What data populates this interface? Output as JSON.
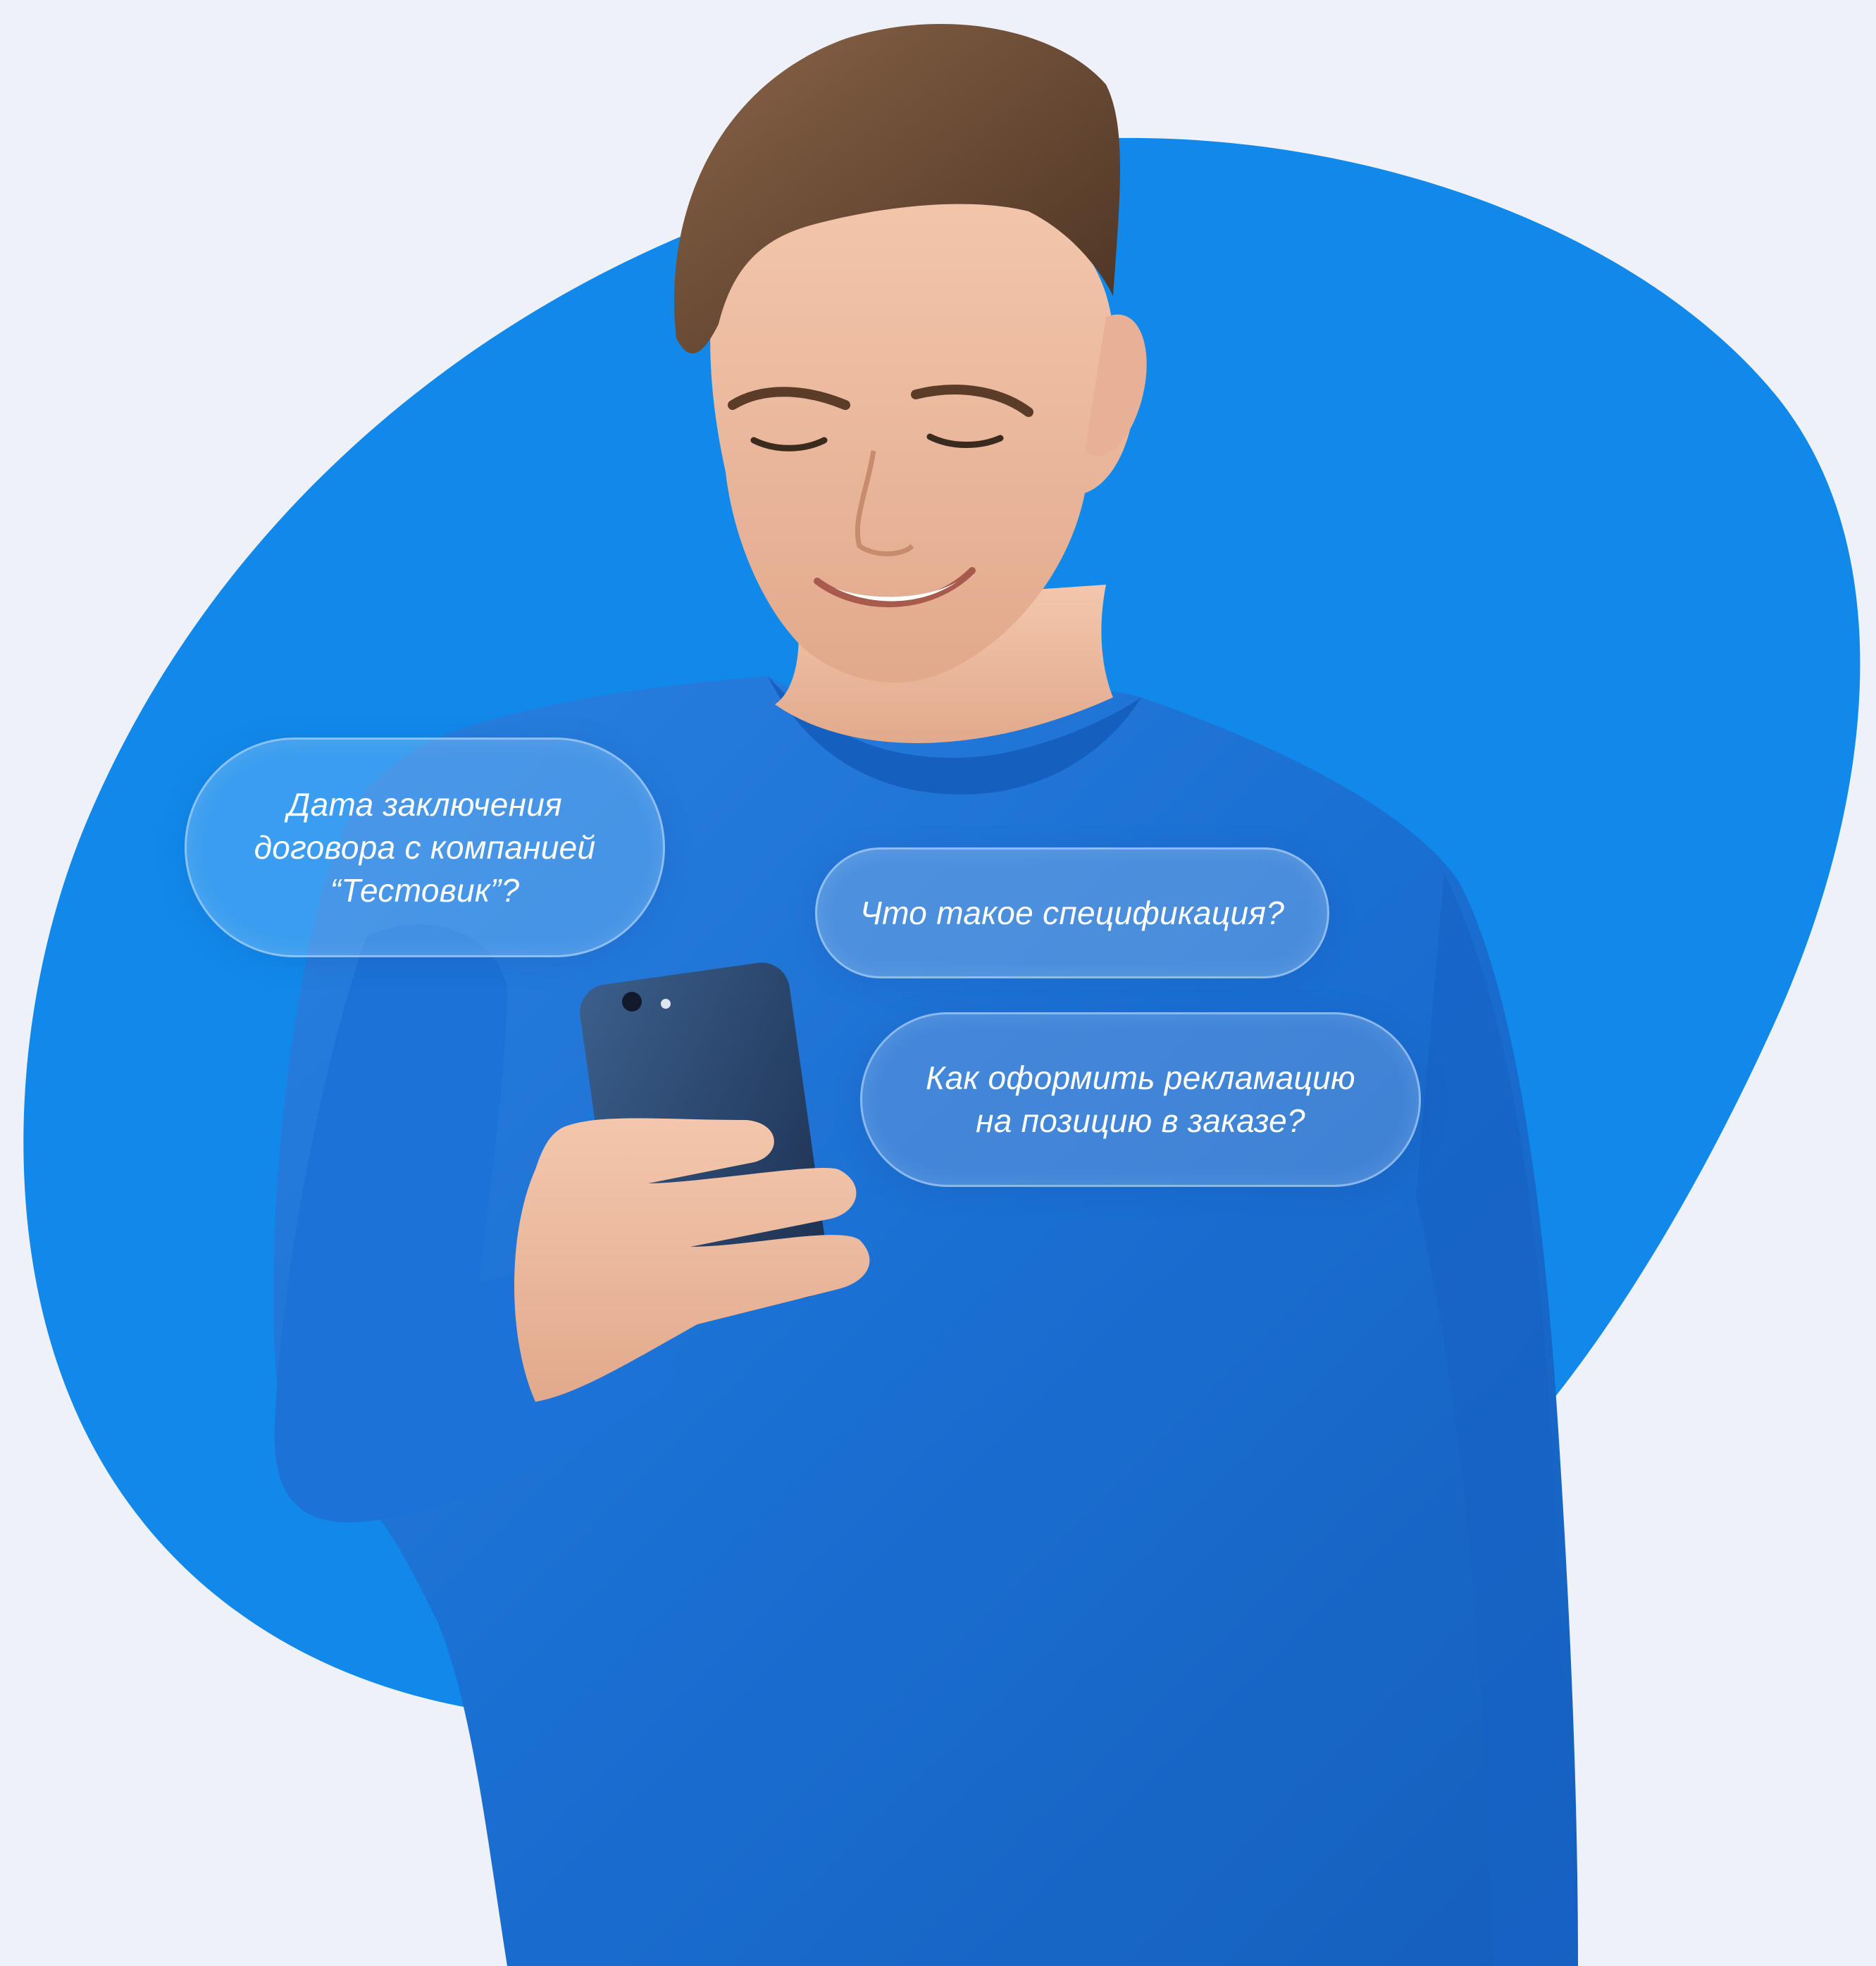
{
  "palette": {
    "background": "#eef1f8",
    "blob": "#1189ea",
    "sweater": "#1a6fd2",
    "bubble_text": "#ffffff"
  },
  "illustration": {
    "subject": "young man in blue sweater looking at smartphone",
    "icons": [
      "person-photo",
      "smartphone-icon"
    ]
  },
  "bubbles": [
    {
      "text": "Дата заключения\nдоговора с компанией\n“Тестовик”?"
    },
    {
      "text": "Что такое спецификация?"
    },
    {
      "text": "Как оформить рекламацию\nна позицию в заказе?"
    }
  ]
}
